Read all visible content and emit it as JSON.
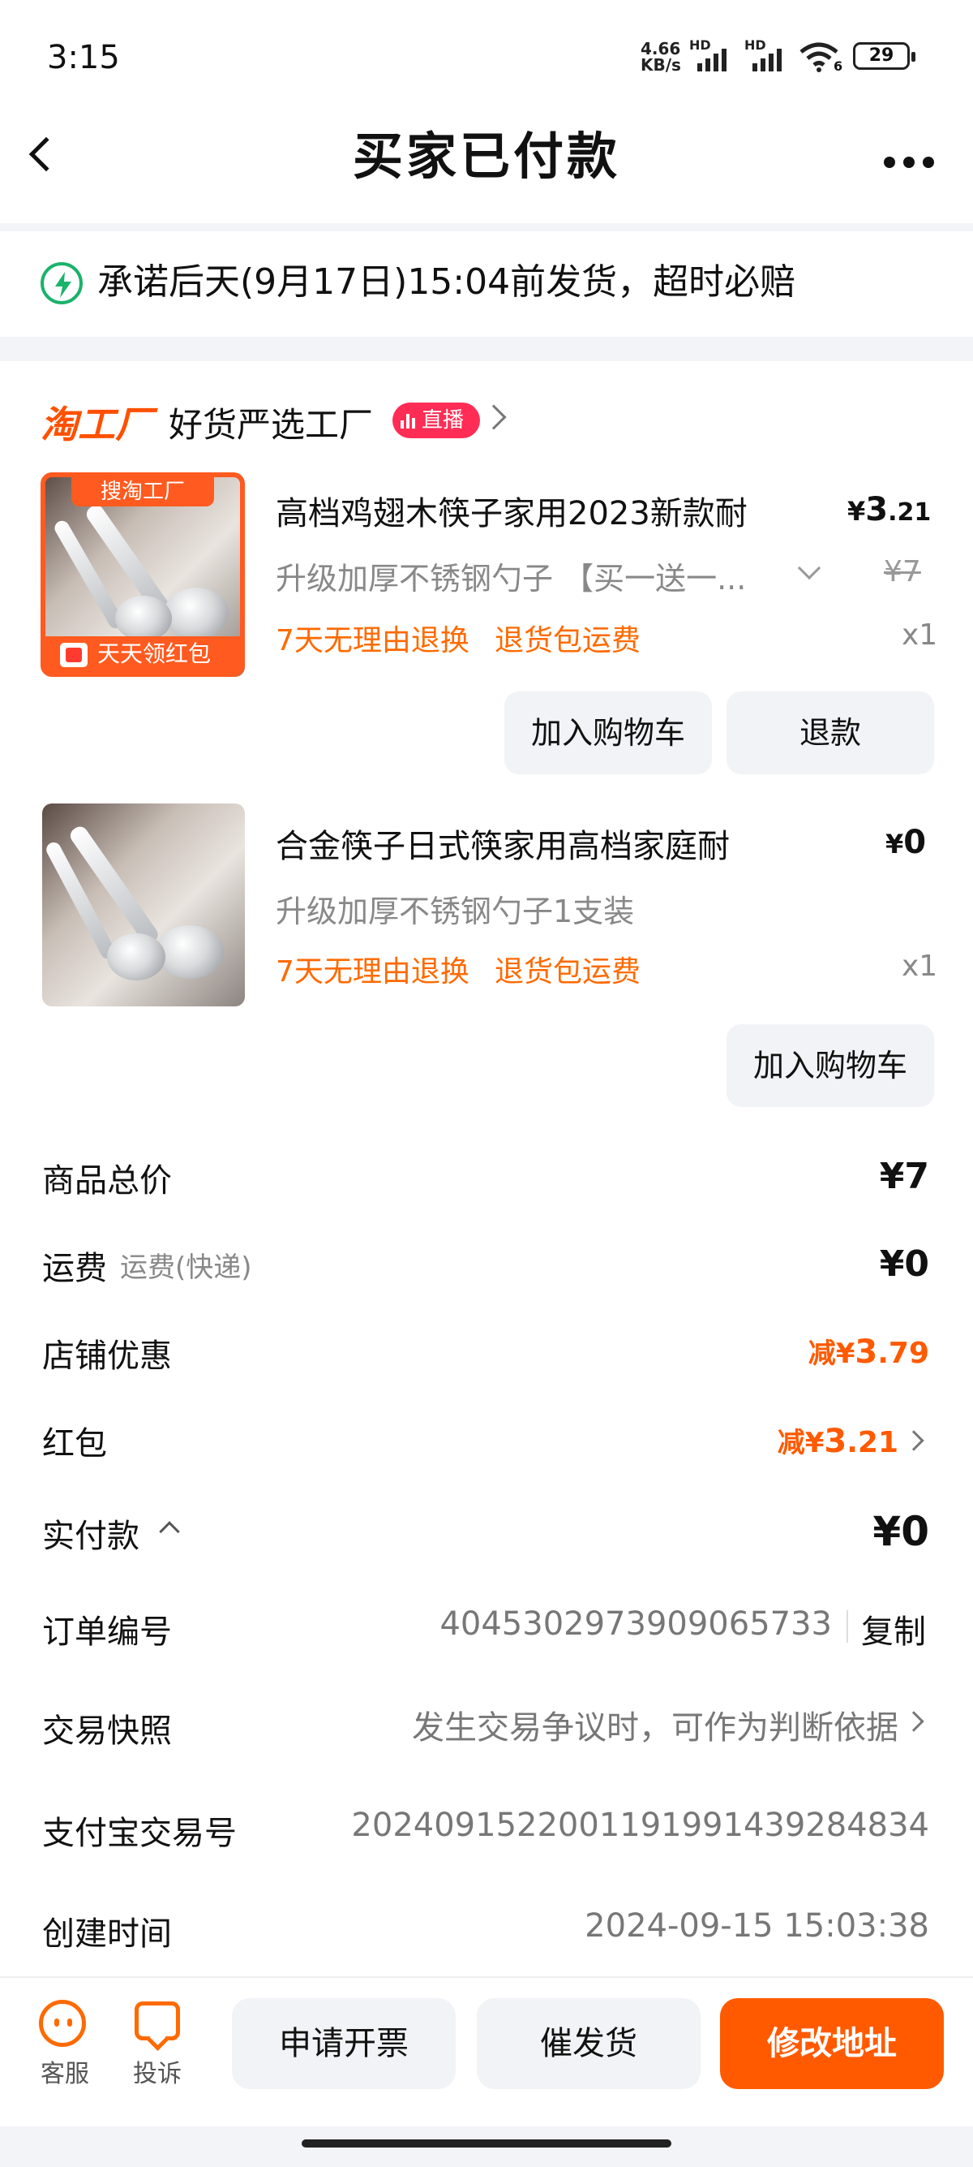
{
  "status_bar": {
    "time": "3:15",
    "net_speed_value": "4.66",
    "net_speed_unit": "KB/s",
    "hd1": "HD",
    "hd2": "HD",
    "wifi_sub": "6",
    "battery": "29"
  },
  "header": {
    "title": "买家已付款",
    "back_icon": "chevron-left-icon",
    "more_icon": "more-dots-icon"
  },
  "promise": {
    "icon": "lightning-icon",
    "text": "承诺后天(9月17日)15:04前发货，超时必赔"
  },
  "shop": {
    "logo": "淘工厂",
    "name": "好货严选工厂",
    "live_badge": "直播"
  },
  "products": [
    {
      "badge_top": "搜淘工厂",
      "badge_bottom": "天天领红包",
      "title": "高档鸡翅木筷子家用2023新款耐",
      "sku": "升级加厚不锈钢勺子 【买一送一...",
      "tag1": "7天无理由退换",
      "tag2": "退货包运费",
      "price_symbol": "¥",
      "price_int": "3",
      "price_dec": ".21",
      "old_price": "¥7",
      "qty": "x1",
      "buttons": [
        "加入购物车",
        "退款"
      ]
    },
    {
      "title": "合金筷子日式筷家用高档家庭耐",
      "sku": "升级加厚不锈钢勺子1支装",
      "tag1": "7天无理由退换",
      "tag2": "退货包运费",
      "price_symbol": "¥",
      "price_int": "0",
      "qty": "x1",
      "buttons": [
        "加入购物车"
      ]
    }
  ],
  "summary": {
    "total_label": "商品总价",
    "total_value": "¥7",
    "shipping_label": "运费",
    "shipping_sub": "运费(快递)",
    "shipping_value": "¥0",
    "shop_discount_label": "店铺优惠",
    "shop_discount_prefix": "减¥",
    "shop_discount_int": "3",
    "shop_discount_dec": ".79",
    "redpacket_label": "红包",
    "redpacket_prefix": "减¥",
    "redpacket_int": "3",
    "redpacket_dec": ".21",
    "paid_label": "实付款",
    "paid_value": "¥0"
  },
  "order_info": {
    "order_no_label": "订单编号",
    "order_no": "4045302973909065733",
    "copy_label": "复制",
    "snapshot_label": "交易快照",
    "snapshot_value": "发生交易争议时，可作为判断依据",
    "alipay_label": "支付宝交易号",
    "alipay_no": "2024091522001191991439284834",
    "created_label": "创建时间",
    "created_time": "2024-09-15 15:03:38"
  },
  "bottom_bar": {
    "service_label": "客服",
    "complaint_label": "投诉",
    "invoice_btn": "申请开票",
    "urge_btn": "催发货",
    "address_btn": "修改地址"
  },
  "colors": {
    "accent": "#ff5a00",
    "tag_orange": "#ff6a00",
    "live_red": "#ff2d55",
    "promise_green": "#1ab36b"
  }
}
